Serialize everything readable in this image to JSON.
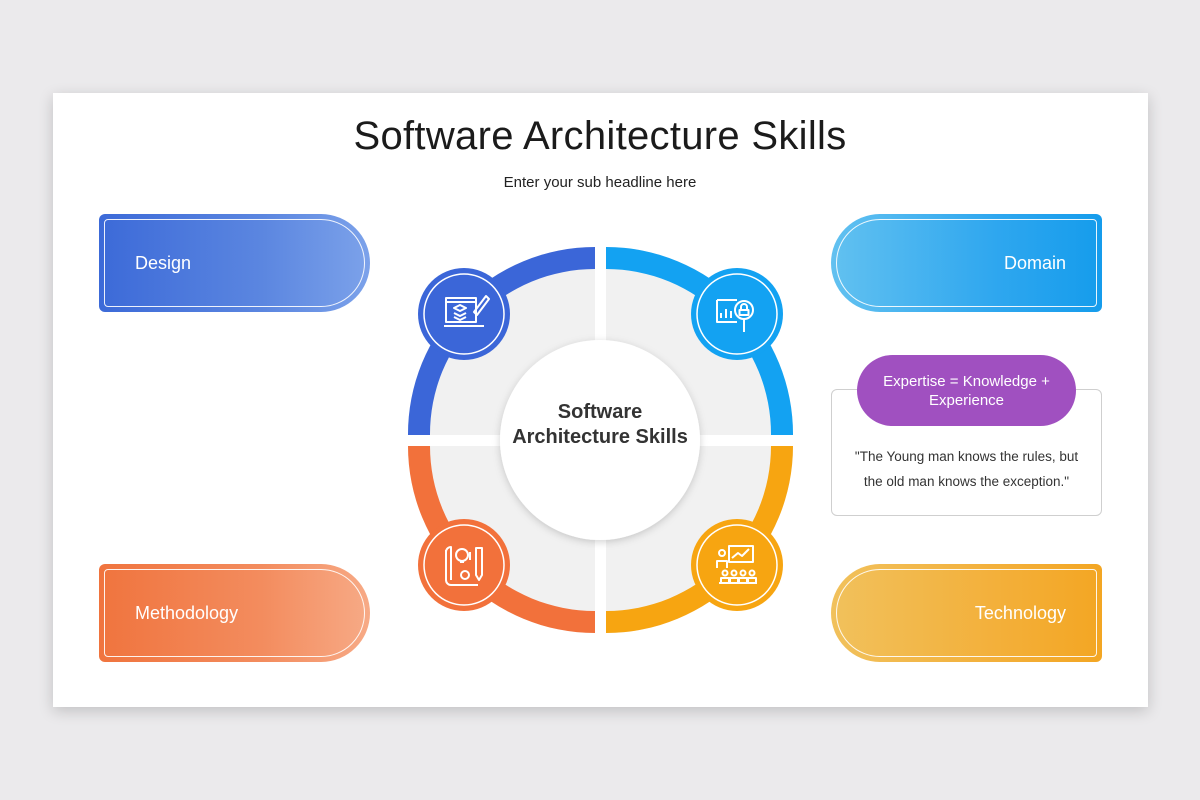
{
  "title": "Software Architecture Skills",
  "subtitle": "Enter your sub headline here",
  "center_label": "Software Architecture Skills",
  "segments": [
    {
      "label": "Design",
      "color": "#3b66d8",
      "icon": "design-blueprint-icon"
    },
    {
      "label": "Domain",
      "color": "#13a2f2",
      "icon": "analytics-document-icon"
    },
    {
      "label": "Methodology",
      "color": "#f2713b",
      "icon": "idea-planning-icon"
    },
    {
      "label": "Technology",
      "color": "#f7a511",
      "icon": "presentation-meeting-icon"
    }
  ],
  "badge": {
    "text": "Expertise = Knowledge + Experience",
    "color": "#a050c0"
  },
  "quote": {
    "line1": "\"The Young man knows the rules, but",
    "line2": "the old man knows the exception.\""
  }
}
